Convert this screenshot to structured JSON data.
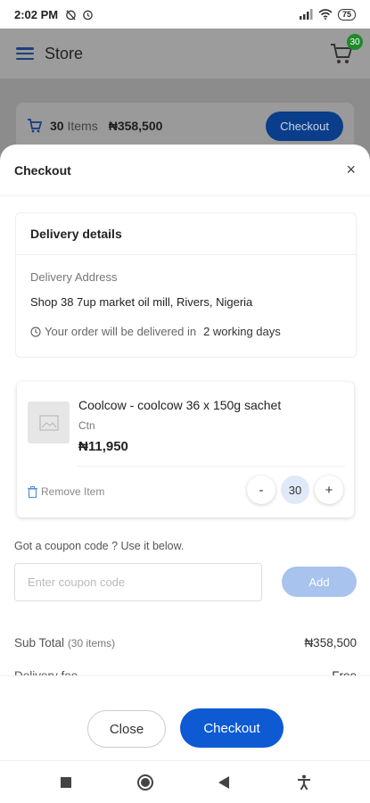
{
  "status_bar": {
    "time": "2:02 PM",
    "battery": "75"
  },
  "app_bar": {
    "title": "Store",
    "cart_count": "30"
  },
  "cart_summary": {
    "items_count": "30",
    "items_label": "Items",
    "total": "₦358,500",
    "checkout_label": "Checkout"
  },
  "sheet": {
    "title": "Checkout",
    "close_symbol": "×"
  },
  "delivery": {
    "header": "Delivery details",
    "address_label": "Delivery Address",
    "address": "Shop 38 7up market oil mill, Rivers, Nigeria",
    "eta_prefix": "Your order will be delivered in",
    "eta_value": "2 working days"
  },
  "cart_item": {
    "name": "Coolcow - coolcow 36 x 150g sachet",
    "unit": "Ctn",
    "price": "₦11,950",
    "remove_label": "Remove Item",
    "quantity": "30",
    "decrement": "-",
    "increment": "+"
  },
  "coupon": {
    "label": "Got a coupon code ? Use it below.",
    "placeholder": "Enter coupon code",
    "value": "",
    "add_label": "Add"
  },
  "totals": {
    "subtotal_label": "Sub Total",
    "subtotal_items": "(30 items)",
    "subtotal_value": "₦358,500",
    "delivery_label": "Delivery fee",
    "delivery_value": "Free"
  },
  "footer": {
    "close_label": "Close",
    "checkout_label": "Checkout"
  },
  "colors": {
    "primary": "#0d5ad2",
    "badge": "#1f8a2b",
    "add_button": "#a7c3ee"
  },
  "icons": {
    "menu": "hamburger-menu-icon",
    "cart": "cart-icon",
    "close": "close-icon",
    "clock": "clock-icon",
    "trash": "trash-icon",
    "image": "image-placeholder-icon",
    "nav_recent": "square-icon",
    "nav_home": "circle-icon",
    "nav_back": "triangle-back-icon",
    "nav_accessibility": "accessibility-icon"
  }
}
